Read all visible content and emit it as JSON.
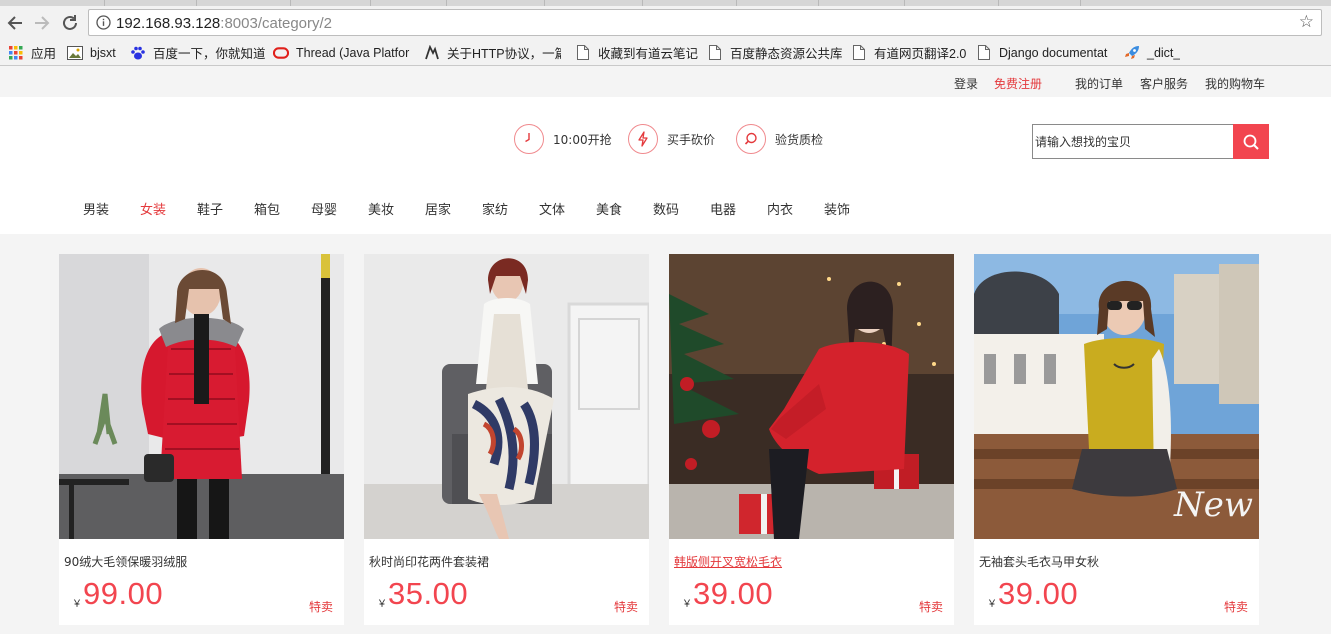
{
  "browser": {
    "url_host": "192.168.93.128",
    "url_rest": ":8003/category/2",
    "bookmarks": [
      {
        "label": "应用",
        "icon": "apps-grid-icon"
      },
      {
        "label": "bjsxt",
        "icon": "image-bookmark-icon"
      },
      {
        "label": "百度一下，你就知道",
        "icon": "baidu-paw-icon"
      },
      {
        "label": "Thread (Java Platfor",
        "icon": "oracle-icon"
      },
      {
        "label": "关于HTTP协议，一篇",
        "icon": "wolf-icon"
      },
      {
        "label": "收藏到有道云笔记",
        "icon": "page-icon"
      },
      {
        "label": "百度静态资源公共库",
        "icon": "page-icon"
      },
      {
        "label": "有道网页翻译2.0",
        "icon": "page-icon"
      },
      {
        "label": "Django documentat",
        "icon": "page-icon"
      },
      {
        "label": "_dict_",
        "icon": "rocket-icon"
      }
    ]
  },
  "topbar": {
    "login": "登录",
    "register": "免费注册",
    "orders": "我的订单",
    "service": "客户服务",
    "cart": "我的购物车"
  },
  "features": [
    {
      "label": "10:00开抢",
      "icon": "clock-icon"
    },
    {
      "label": "买手砍价",
      "icon": "lightning-icon"
    },
    {
      "label": "验货质检",
      "icon": "magnifier-icon"
    }
  ],
  "search": {
    "placeholder": "请输入想找的宝贝"
  },
  "categories": [
    "男装",
    "女装",
    "鞋子",
    "箱包",
    "母婴",
    "美妆",
    "居家",
    "家纺",
    "文体",
    "美食",
    "数码",
    "电器",
    "内衣",
    "装饰"
  ],
  "active_category": "女装",
  "products": [
    {
      "name": "90绒大毛领保暖羽绒服",
      "currency": "￥",
      "price": "99.00",
      "tag": "特卖"
    },
    {
      "name": "秋时尚印花两件套装裙",
      "currency": "￥",
      "price": "35.00",
      "tag": "特卖"
    },
    {
      "name": "韩版侧开叉宽松毛衣",
      "currency": "￥",
      "price": "39.00",
      "tag": "特卖"
    },
    {
      "name": "无袖套头毛衣马甲女秋",
      "currency": "￥",
      "price": "39.00",
      "tag": "特卖"
    }
  ],
  "photo_overlay_text": "New",
  "colors": {
    "accent": "#f2454f",
    "active_text": "#e4393c"
  }
}
